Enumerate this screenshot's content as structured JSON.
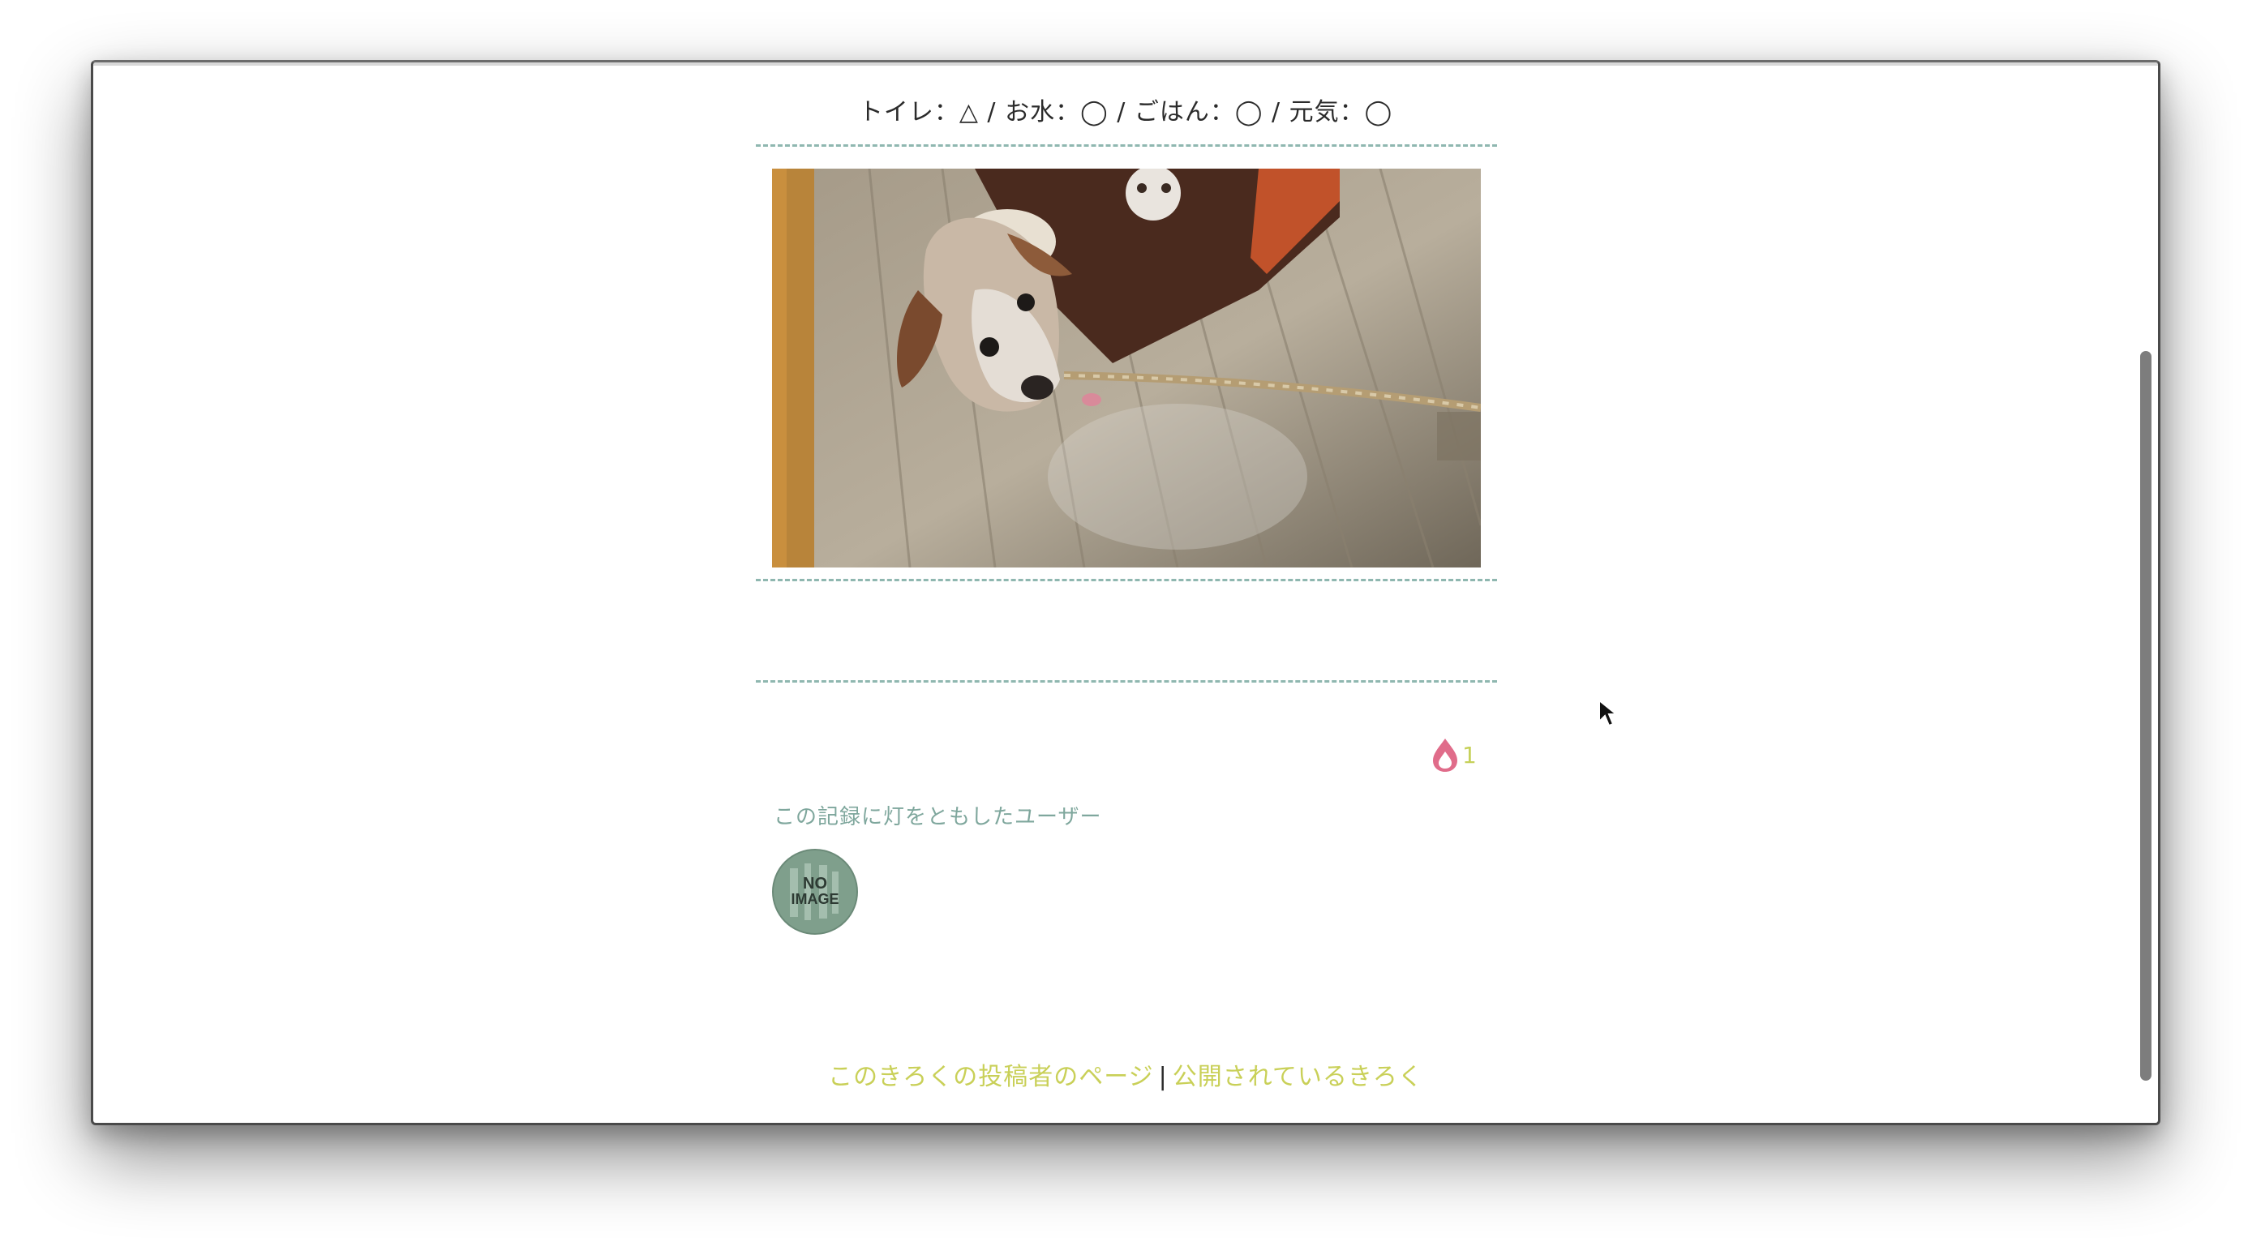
{
  "record": {
    "status_line": "トイレ：△ / お水：◯ / ごはん：◯ / 元気：◯",
    "photo_icon": "dog-photo",
    "light_count": "1",
    "light_icon": "flame-icon",
    "lit_users_label": "この記録に灯をともしたユーザー",
    "avatar_text_line1": "NO",
    "avatar_text_line2": "IMAGE"
  },
  "footer": {
    "poster_page_link": "このきろくの投稿者のページ",
    "separator": "|",
    "public_records_link": "公開されているきろく"
  },
  "colors": {
    "accent_link": "#c9d058",
    "label_teal": "#7fa79d",
    "divider": "#8fb7b0",
    "flame": "#e06c8a"
  }
}
